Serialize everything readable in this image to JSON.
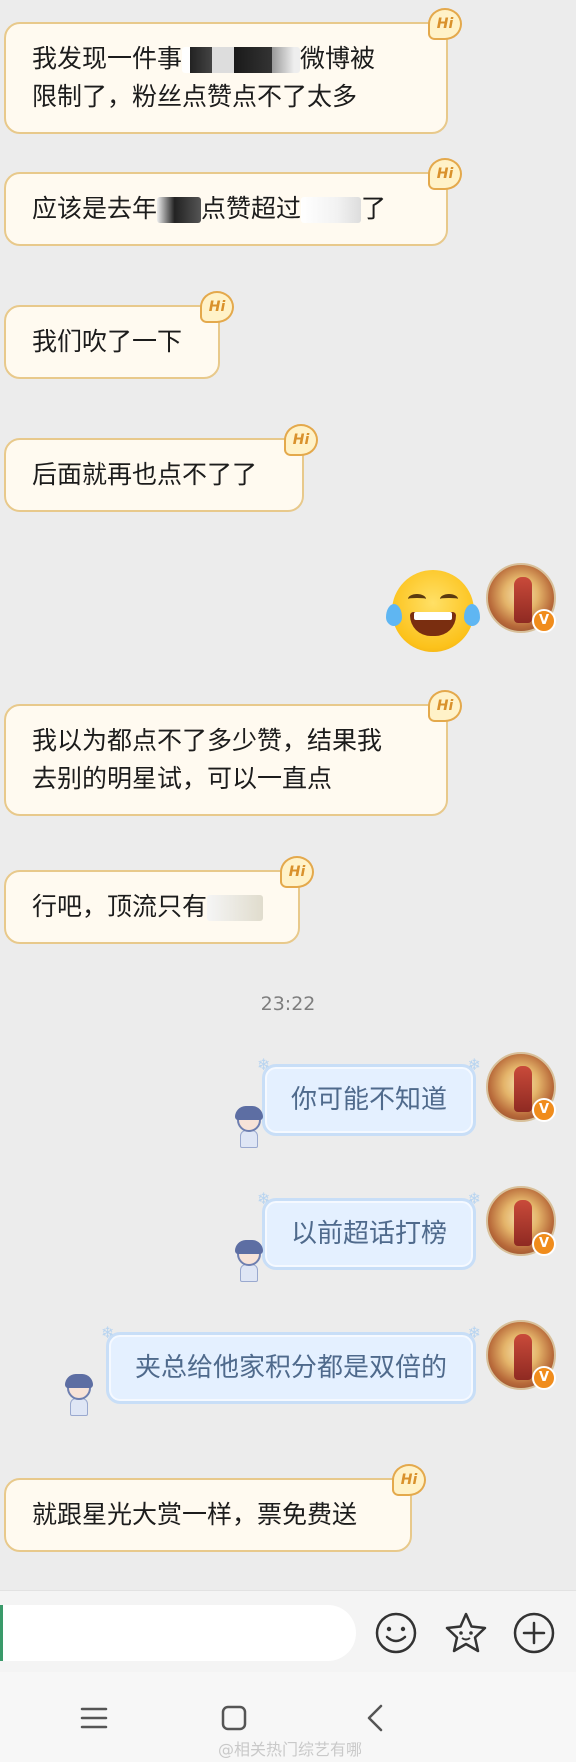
{
  "messages_in": [
    {
      "line1_a": "我发现一件事",
      "line1_b": "微博被",
      "line2": "限制了，粉丝点赞点不了太多"
    },
    {
      "a": "应该是去年",
      "b": "点赞超过",
      "c": "了"
    },
    {
      "text": "我们吹了一下"
    },
    {
      "text": "后面就再也点不了了"
    },
    {
      "line1": "我以为都点不了多少赞，结果我",
      "line2": "去别的明星试，可以一直点"
    },
    {
      "text": "行吧，顶流只有"
    },
    {
      "text": "就跟星光大赏一样，票免费送"
    }
  ],
  "hi_label": "Hi",
  "timestamp": "23:22",
  "messages_out": [
    {
      "text": "你可能不知道"
    },
    {
      "text": "以前超话打榜"
    },
    {
      "text": "夹总给他家积分都是双倍的"
    }
  ],
  "verified_badge": "V",
  "input": {
    "placeholder": ""
  },
  "watermark": "@相关热门综艺有哪",
  "icons": [
    "emoji-smile-icon",
    "sticker-star-icon",
    "plus-circle-icon",
    "menu-icon",
    "home-square-icon",
    "back-icon",
    "laughing-tears-emoji"
  ],
  "colors": {
    "incoming_border": "#e8c98b",
    "outgoing_bg": "#e4f0ff",
    "verified": "#f08c1c"
  }
}
